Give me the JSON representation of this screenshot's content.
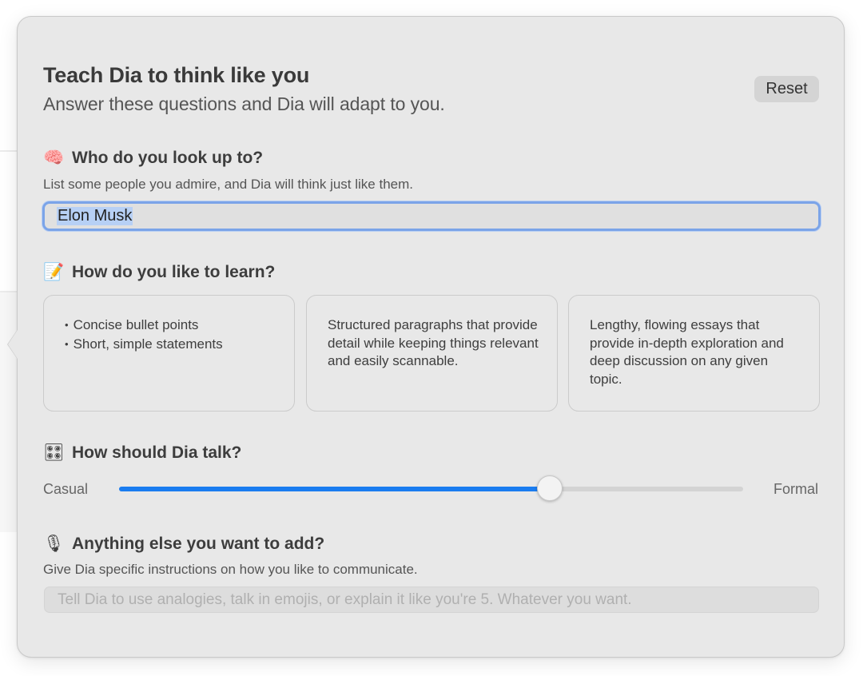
{
  "header": {
    "title": "Teach Dia to think like you",
    "subtitle": "Answer these questions and Dia will adapt to you.",
    "reset_label": "Reset"
  },
  "sections": {
    "look_up": {
      "icon": "brain-icon",
      "title": "Who do you look up to?",
      "description": "List some people you admire, and Dia will think just like them.",
      "value": "Elon Musk"
    },
    "learn": {
      "icon": "memo-icon",
      "title": "How do you like to learn?",
      "options": [
        {
          "bullets": [
            "Concise bullet points",
            "Short, simple statements"
          ]
        },
        {
          "text": "Structured paragraphs that provide detail while keeping things relevant and easily scannable."
        },
        {
          "text": "Lengthy, flowing essays that provide in-depth exploration and deep discussion on any given topic."
        }
      ]
    },
    "talk": {
      "icon": "control-knobs-icon",
      "title": "How should Dia talk?",
      "min_label": "Casual",
      "max_label": "Formal",
      "value_fraction": 0.69,
      "accent_color": "#1a7cf0"
    },
    "add": {
      "icon": "microphone-icon",
      "title": "Anything else you want to add?",
      "description": "Give Dia specific instructions on how you like to communicate.",
      "placeholder": "Tell Dia to use analogies, talk in emojis, or explain it like you're 5. Whatever you want."
    }
  }
}
